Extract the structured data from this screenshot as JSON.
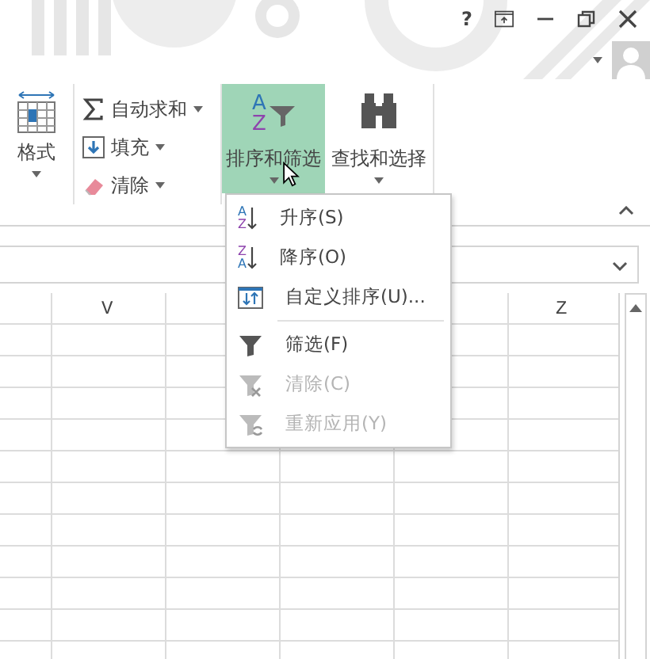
{
  "title_bar": {
    "help": "?"
  },
  "ribbon": {
    "format": {
      "label": "格式"
    },
    "editing": [
      {
        "kind": "sum",
        "label": "自动求和"
      },
      {
        "kind": "fill",
        "label": "填充"
      },
      {
        "kind": "clear",
        "label": "清除"
      }
    ],
    "sort_filter": {
      "icon_letters": [
        "A",
        "Z"
      ],
      "label": "排序和筛选",
      "open": true
    },
    "find_select": {
      "label": "查找和选择"
    }
  },
  "menu": {
    "items": [
      {
        "kind": "asc",
        "icon_letters": [
          "A",
          "Z"
        ],
        "label": "升序(S)",
        "disabled": false
      },
      {
        "kind": "desc",
        "icon_letters": [
          "Z",
          "A"
        ],
        "label": "降序(O)",
        "disabled": false
      },
      {
        "kind": "custom",
        "label": "自定义排序(U)...",
        "disabled": false
      },
      {
        "kind": "separator"
      },
      {
        "kind": "filter",
        "label": "筛选(F)",
        "disabled": false
      },
      {
        "kind": "clear",
        "label": "清除(C)",
        "disabled": true
      },
      {
        "kind": "reapply",
        "label": "重新应用(Y)",
        "disabled": true
      }
    ]
  },
  "sheet": {
    "columns": [
      {
        "label": "V"
      },
      {},
      {},
      {},
      {
        "label": "Z"
      }
    ]
  }
}
